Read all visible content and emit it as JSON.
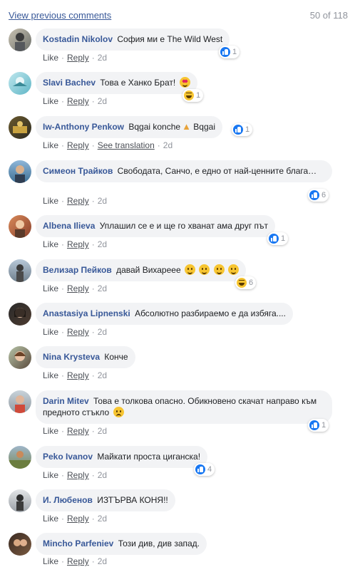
{
  "header": {
    "view_previous": "View previous comments",
    "count": "50 of 118"
  },
  "actions": {
    "like": "Like",
    "reply": "Reply",
    "see_translation": "See translation",
    "sep": "·"
  },
  "comments": [
    {
      "name": "Kostadin Nikolov",
      "text": "София ми е The Wild West",
      "reaction_count": "1",
      "time": "2d"
    },
    {
      "name": "Slavi Bachev",
      "text": "Това е Ханко Брат!",
      "reaction_count": "1",
      "time": "2d"
    },
    {
      "name": "Iw-Anthony Penkow",
      "text": "Bqgai konche",
      "text2": "Bqgai",
      "reaction_count": "1",
      "time": "2d"
    },
    {
      "name": "Симеон Трайков",
      "text": "Свободата, Санчо, е едно от най-ценните блага…",
      "reaction_count": "6",
      "time": "2d"
    },
    {
      "name": "Albena Ilieva",
      "text": "Уплашил се е и ще го хванат ама друг път",
      "reaction_count": "1",
      "time": "2d"
    },
    {
      "name": "Велизар Пейков",
      "text": "давай Вихареее",
      "reaction_count": "6",
      "time": "2d"
    },
    {
      "name": "Anastasiya Lipnenski",
      "text": "Абсолютно разбираемо е да избяга....",
      "time": "2d"
    },
    {
      "name": "Nina Krysteva",
      "text": "Конче",
      "time": "2d"
    },
    {
      "name": "Darin Mitev",
      "text": "Това е толкова опасно. Обикновено скачат направо към предното стъкло",
      "reaction_count": "1",
      "time": "2d"
    },
    {
      "name": "Peko Ivanov",
      "text": "Майкати проста циганска!",
      "reaction_count": "4",
      "time": "2d"
    },
    {
      "name": "И. Любенов",
      "text": "ИЗТЪРВА КОНЯ!!",
      "time": "2d"
    },
    {
      "name": "Mincho Parfeniev",
      "text": "Този див, див запад.",
      "time": "2d"
    }
  ]
}
